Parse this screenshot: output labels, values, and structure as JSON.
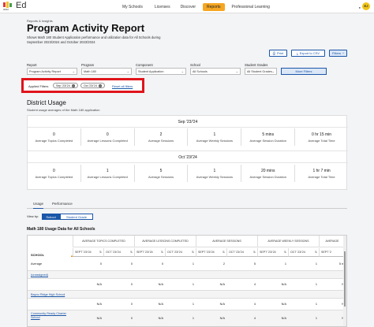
{
  "nav": {
    "brand": "Ed",
    "logo_text": "HMH",
    "items": [
      "My Schools",
      "Licenses",
      "Discover",
      "Reports",
      "Professional Learning"
    ],
    "active": "Reports",
    "avatar": "EJ"
  },
  "header": {
    "breadcrumb": "Reports & Insights",
    "title": "Program Activity Report",
    "subtitle": "Shows Math 180 Student Application performance and utilization data for All Schools during September 2023/2024 and October 2023/2024",
    "buttons": {
      "print": "Print",
      "export": "Export to CSV",
      "filters": "Filters"
    }
  },
  "filters": {
    "report": {
      "label": "Report",
      "value": "Program Activity Report"
    },
    "program": {
      "label": "Program",
      "value": "Math 180"
    },
    "component": {
      "label": "Component",
      "value": "Student Application"
    },
    "school": {
      "label": "School",
      "value": "All Schools"
    },
    "grades": {
      "label": "Student Grades",
      "value": "All Student Grades"
    },
    "more": "More Filters"
  },
  "applied": {
    "label": "Applied Filters",
    "chips": [
      "Sep '23/'24",
      "Oct '23/'24"
    ],
    "reset": "Reset all filters"
  },
  "district": {
    "title": "District Usage",
    "subtitle": "Student usage averages of the Math 180 application",
    "periods": [
      {
        "name": "Sep '23/'24",
        "stats": [
          {
            "value": "0",
            "label": "Average Topics Completed"
          },
          {
            "value": "0",
            "label": "Average Lessons Completed"
          },
          {
            "value": "2",
            "label": "Average Sessions"
          },
          {
            "value": "1",
            "label": "Average Weekly Sessions"
          },
          {
            "value": "5 mins",
            "label": "Average Session Duration"
          },
          {
            "value": "0 hr 15 min",
            "label": "Average Total Time"
          }
        ]
      },
      {
        "name": "Oct '23/'24",
        "stats": [
          {
            "value": "0",
            "label": "Average Topics Completed"
          },
          {
            "value": "1",
            "label": "Average Lessons Completed"
          },
          {
            "value": "5",
            "label": "Average Sessions"
          },
          {
            "value": "1",
            "label": "Average Weekly Sessions"
          },
          {
            "value": "20 mins",
            "label": "Average Session Duration"
          },
          {
            "value": "1 hr 7 min",
            "label": "Average Total Time"
          }
        ]
      }
    ]
  },
  "tabs": {
    "items": [
      "Usage",
      "Performance"
    ],
    "active": "Usage"
  },
  "viewby": {
    "label": "View by:",
    "options": [
      "School",
      "Student Grade"
    ],
    "selected": "School"
  },
  "table": {
    "title": "Math 180 Usage Data for All Schools",
    "school_header": "SCHOOL",
    "groups": [
      "AVERAGE TOPICS COMPLETED",
      "AVERAGE LESSONS COMPLETED",
      "AVERAGE SESSIONS",
      "AVERAGE WEEKLY SESSIONS",
      "AVERAGE"
    ],
    "subheaders": [
      "SEPT '23/'24",
      "OCT '23/'24",
      "SEPT '23/'24",
      "OCT '23/'24",
      "SEPT '23/'24",
      "OCT '23/'24",
      "SEPT '23/'24",
      "OCT '23/'24",
      "SEPT '2"
    ],
    "rows": [
      {
        "name": "Average",
        "link": false,
        "cells": [
          "0",
          "0",
          "0",
          "1",
          "2",
          "5",
          "1",
          "1",
          "5 mi"
        ]
      },
      {
        "name": "(unassigned)",
        "link": true,
        "cells": [
          "",
          "",
          "",
          "",
          "",
          "",
          "",
          "",
          ""
        ]
      },
      {
        "name": "",
        "link": false,
        "cells": [
          "N/A",
          "0",
          "N/A",
          "1",
          "N/A",
          "4",
          "N/A",
          "1",
          "N/"
        ]
      },
      {
        "name": "Bayou Ridge High School",
        "link": true,
        "cells": [
          "",
          "",
          "",
          "",
          "",
          "",
          "",
          "",
          ""
        ]
      },
      {
        "name": "",
        "link": false,
        "cells": [
          "N/A",
          "0",
          "N/A",
          "1",
          "N/A",
          "4",
          "N/A",
          "1",
          "N/"
        ]
      },
      {
        "name": "Community Ready Charter School",
        "link": true,
        "cells": [
          "N/A",
          "0",
          "N/A",
          "1",
          "N/A",
          "4",
          "N/A",
          "1",
          "N/"
        ]
      }
    ]
  },
  "colors": {
    "accent": "#1a56a8",
    "active_nav": "#f5a623",
    "highlight": "#e0141b"
  }
}
